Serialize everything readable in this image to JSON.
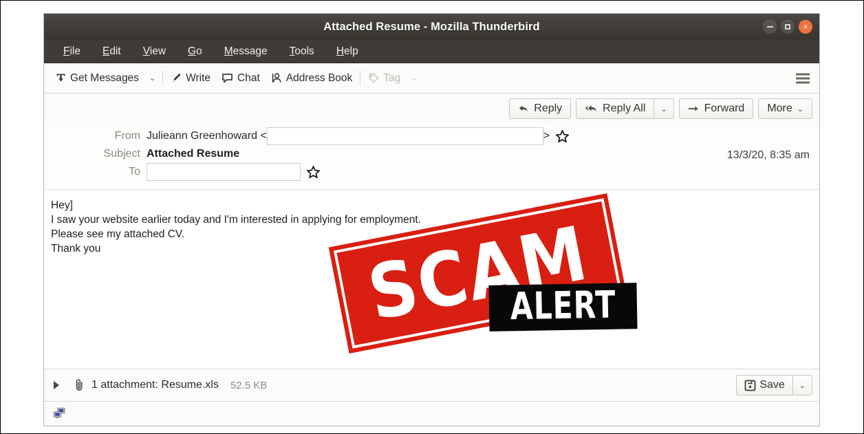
{
  "window": {
    "title": "Attached Resume - Mozilla Thunderbird",
    "controls": {
      "minimize": "minimize",
      "maximize": "maximize",
      "close": "×"
    }
  },
  "menubar": {
    "items": [
      {
        "label": "File",
        "accel": "F",
        "rest": "ile"
      },
      {
        "label": "Edit",
        "accel": "E",
        "rest": "dit"
      },
      {
        "label": "View",
        "accel": "V",
        "rest": "iew"
      },
      {
        "label": "Go",
        "accel": "G",
        "rest": "o"
      },
      {
        "label": "Message",
        "accel": "M",
        "rest": "essage"
      },
      {
        "label": "Tools",
        "accel": "T",
        "rest": "ools"
      },
      {
        "label": "Help",
        "accel": "H",
        "rest": "elp"
      }
    ]
  },
  "toolbar": {
    "get_messages": "Get Messages",
    "get_messages_caret": "⌄",
    "write": "Write",
    "chat": "Chat",
    "address_book": "Address Book",
    "tag": "Tag",
    "tag_caret": "⌄",
    "app_menu": "app-menu"
  },
  "replybar": {
    "reply": "Reply",
    "reply_all": "Reply All",
    "reply_all_caret": "⌄",
    "forward": "Forward",
    "more": "More",
    "more_caret": "⌄"
  },
  "message": {
    "from_label": "From",
    "from_name": "Julieann Greenhoward <",
    "from_close": ">",
    "from_address_redacted": "",
    "subject_label": "Subject",
    "subject": "Attached Resume",
    "to_label": "To",
    "to_address_redacted": "",
    "date": "13/3/20, 8:35 am",
    "body_lines": [
      "Hey]",
      "I saw your website earlier today and I'm interested in applying for employment.",
      "Please see my attached CV.",
      "Thank you"
    ]
  },
  "stamp": {
    "scam": "SCAM",
    "alert": "ALERT",
    "red": "#d91f11",
    "black": "#08070a"
  },
  "attachment": {
    "summary": "1 attachment: Resume.xls",
    "size": "52.5 KB",
    "save_label": "Save",
    "save_caret": "⌄"
  },
  "statusbar": {
    "icon": "network-computers-icon"
  }
}
